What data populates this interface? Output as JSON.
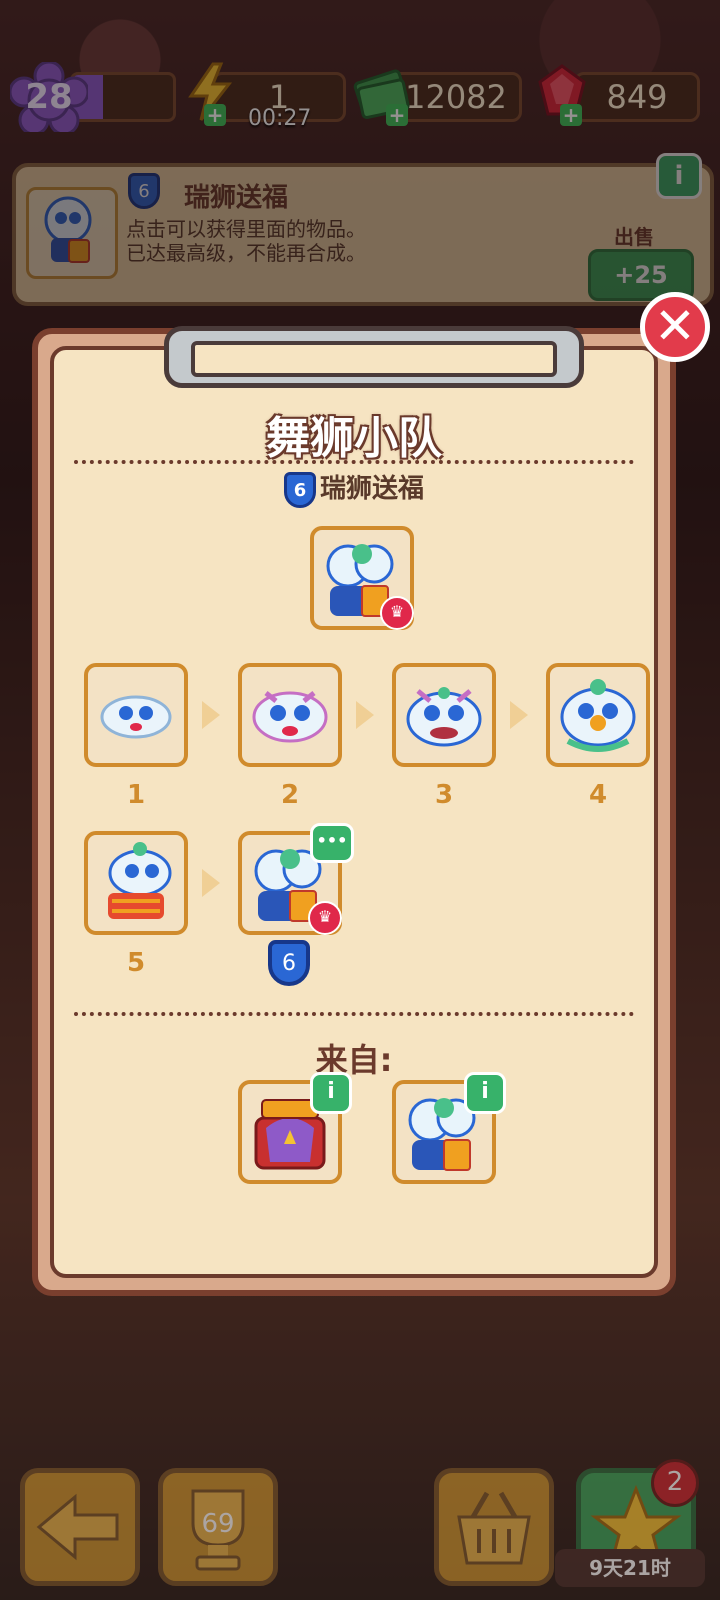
{
  "topbar": {
    "level": "28",
    "energy": "1",
    "energy_timer": "00:27",
    "cash": "12082",
    "gems": "849"
  },
  "info_panel": {
    "tier": "6",
    "title": "瑞狮送福",
    "desc_line1": "点击可以获得里面的物品。",
    "desc_line2": "已达最高级，不能再合成。",
    "sell_label": "出售",
    "sell_price": "+25",
    "info_icon": "i"
  },
  "modal": {
    "title": "舞狮小队",
    "subtitle_tier": "6",
    "subtitle": "瑞狮送福",
    "chain": [
      {
        "level": "1"
      },
      {
        "level": "2"
      },
      {
        "level": "3"
      },
      {
        "level": "4"
      },
      {
        "level": "5"
      },
      {
        "level": "6"
      }
    ],
    "final_tier": "6",
    "more_icon": "•••",
    "from_label": "来自:",
    "sources": [
      {
        "name": "gift-box",
        "info_icon": "i"
      },
      {
        "name": "lion-dance-bundle",
        "info_icon": "i"
      }
    ],
    "close_icon": "✕"
  },
  "bottom": {
    "trophy_count": "69",
    "star_badge": "2",
    "event_timer": "9天21时"
  },
  "colors": {
    "accent_green": "#37b26a",
    "modal_bg": "#f6e4c2",
    "close_red": "#e23b4b",
    "tier_blue": "#2a67d4",
    "item_border": "#d08b2c"
  }
}
